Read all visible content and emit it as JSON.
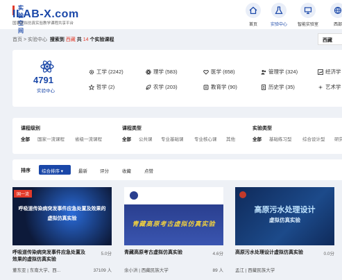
{
  "header": {
    "logo_top": "实验空间",
    "logo_main": "ILAB-X.com",
    "logo_sub": "国家虚拟仿真实验教学课程共享平台",
    "nav": [
      {
        "label": "首页",
        "icon": "home-icon"
      },
      {
        "label": "实验中心",
        "icon": "flask-icon",
        "active": true
      },
      {
        "label": "智能实验室",
        "icon": "lab-icon"
      },
      {
        "label": "西部",
        "icon": "globe-icon"
      }
    ]
  },
  "breadcrumb": {
    "home": "首页",
    "sep": ">",
    "center": "实验中心",
    "search_prefix": "搜索到",
    "region": "西藏",
    "mid": "共",
    "count": "14",
    "suffix": "个实验课程"
  },
  "region_select": "西藏",
  "categories": {
    "total": "4791",
    "total_label": "实验中心",
    "items": [
      {
        "label": "工学 (2242)",
        "icon": "gear-icon"
      },
      {
        "label": "理学 (583)",
        "icon": "atom-icon"
      },
      {
        "label": "医学 (658)",
        "icon": "heart-icon"
      },
      {
        "label": "管理学 (324)",
        "icon": "people-icon"
      },
      {
        "label": "经济学",
        "icon": "chart-icon"
      },
      {
        "label": "哲学 (2)",
        "icon": "star-icon"
      },
      {
        "label": "农学 (203)",
        "icon": "leaf-icon"
      },
      {
        "label": "教育学 (90)",
        "icon": "book-icon"
      },
      {
        "label": "历史学 (35)",
        "icon": "scroll-icon"
      },
      {
        "label": "艺术学",
        "icon": "palette-icon"
      }
    ]
  },
  "filters": {
    "level": {
      "title": "课程级别",
      "options": [
        "全部",
        "国家一流课程",
        "省级一流课程"
      ]
    },
    "type": {
      "title": "课程类型",
      "options": [
        "全部",
        "公共课",
        "专业基础课",
        "专业核心课",
        "其他"
      ]
    },
    "exp_type": {
      "title": "实验类型",
      "options": [
        "全部",
        "基础练习型",
        "综合设计型",
        "研究"
      ]
    }
  },
  "sort": {
    "label": "排序",
    "selected": "综合排序 ▾",
    "options": [
      "最新",
      "评分",
      "收藏",
      "点赞"
    ]
  },
  "cards": [
    {
      "badge": "国一流",
      "thumb_line1": "呼吸道传染病突发事件应急处置及效果的",
      "thumb_line2": "虚拟仿真实验",
      "title": "呼吸道传染病突发事件应急处置及效果的虚拟仿真实验",
      "score": "5.0分",
      "meta": "董东亚 | 东南大学、西...",
      "count": "37109 人",
      "colors": {
        "bg": "#0d1a3a",
        "accent": "#2a6bd8"
      }
    },
    {
      "thumb_line1": "青藏高原考古虚拟仿真实验",
      "title": "青藏高原考古虚拟仿真实验",
      "score": "4.6分",
      "meta": "余小洪 | 西藏民族大学",
      "count": "89 人",
      "colors": {
        "bg": "#2a3f8f",
        "accent": "#f0d040"
      }
    },
    {
      "thumb_line1": "高原污水处理设计",
      "thumb_line2": "虚拟仿真实验",
      "title": "高原污水处理设计虚拟仿真实验",
      "score": "0.0分",
      "meta": "孟江 | 西藏民族大学",
      "count": "",
      "colors": {
        "bg": "#0f2a5a",
        "accent": "#3fa0e8"
      }
    }
  ]
}
